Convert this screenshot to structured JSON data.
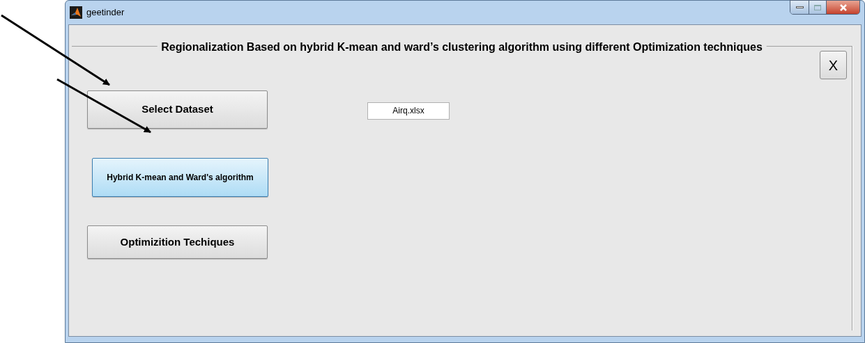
{
  "window": {
    "title": "geetinder"
  },
  "panel": {
    "title": "Regionalization Based on hybrid K-mean and ward’s clustering algorithm using different Optimization techniques"
  },
  "close_button": {
    "label": "X"
  },
  "buttons": [
    {
      "label": "Select Dataset",
      "selected": false
    },
    {
      "label": "Hybrid K-mean and Ward's algorithm",
      "selected": true
    },
    {
      "label": "Optimizition Techiques",
      "selected": false
    }
  ],
  "file_field": {
    "value": "Airq.xlsx"
  }
}
